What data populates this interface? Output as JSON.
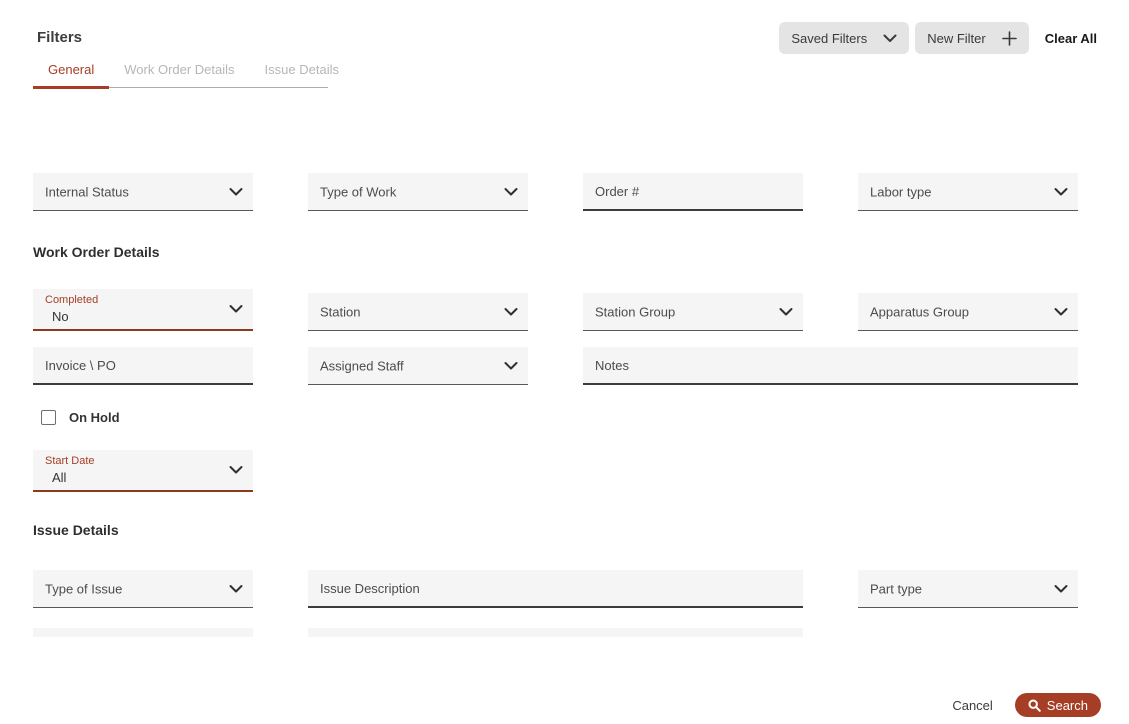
{
  "colors": {
    "accent": "#a53e25",
    "accent_dark": "#8f3a1f",
    "field_bg": "#f5f5f5",
    "button_gray": "#e4e4e4"
  },
  "header": {
    "title": "Filters",
    "tabs": [
      {
        "label": "General",
        "active": true
      },
      {
        "label": "Work Order Details",
        "active": false
      },
      {
        "label": "Issue Details",
        "active": false
      }
    ],
    "saved_filters_label": "Saved Filters",
    "new_filter_label": "New Filter",
    "clear_all_label": "Clear All"
  },
  "general": {
    "internal_status_label": "Internal Status",
    "type_of_work_label": "Type of Work",
    "order_number_placeholder": "Order #",
    "order_number_value": "",
    "labor_type_label": "Labor type"
  },
  "work_order_details": {
    "section_title": "Work Order Details",
    "completed_label": "Completed",
    "completed_value": "No",
    "station_label": "Station",
    "station_group_label": "Station Group",
    "apparatus_group_label": "Apparatus Group",
    "invoice_po_placeholder": "Invoice \\ PO",
    "invoice_po_value": "",
    "assigned_staff_label": "Assigned Staff",
    "notes_placeholder": "Notes",
    "notes_value": "",
    "on_hold_label": "On Hold",
    "on_hold_checked": false,
    "start_date_label": "Start Date",
    "start_date_value": "All"
  },
  "issue_details": {
    "section_title": "Issue Details",
    "type_of_issue_label": "Type of Issue",
    "issue_description_placeholder": "Issue Description",
    "issue_description_value": "",
    "part_type_label": "Part type"
  },
  "footer": {
    "cancel_label": "Cancel",
    "search_label": "Search"
  }
}
